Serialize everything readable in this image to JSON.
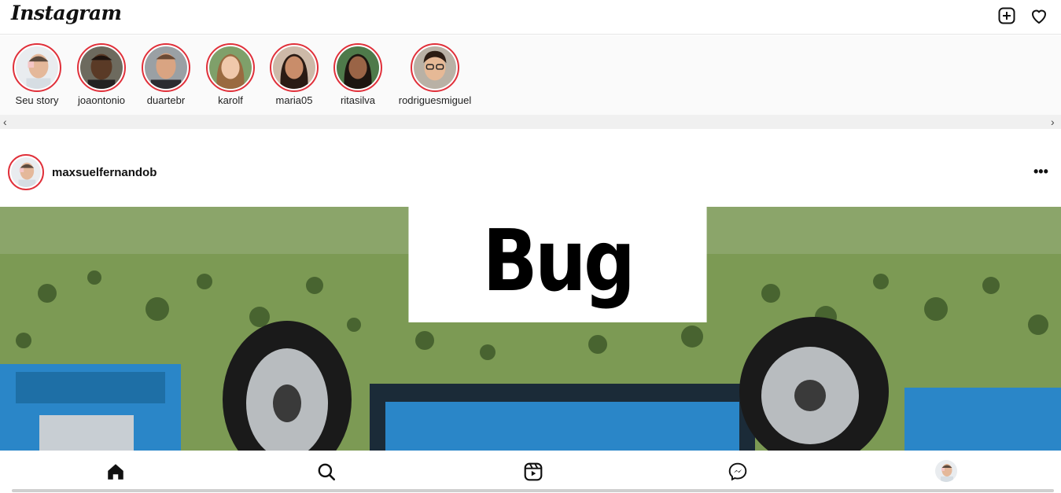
{
  "app": {
    "logo_text": "Instagram"
  },
  "topbar": {
    "icons": [
      "add-post-icon",
      "heart-icon"
    ]
  },
  "stories": [
    {
      "username": "Seu story"
    },
    {
      "username": "joaontonio"
    },
    {
      "username": "duartebr"
    },
    {
      "username": "karolf"
    },
    {
      "username": "maria05"
    },
    {
      "username": "ritasilva"
    },
    {
      "username": "rodriguesmiguel"
    }
  ],
  "scroll": {
    "left_arrow": "‹",
    "right_arrow": "›"
  },
  "post": {
    "username": "maxsuelfernandob",
    "more_label": "•••",
    "image_caption_text": "Bug"
  },
  "bottom_nav": {
    "icons": [
      "home-icon",
      "search-icon",
      "reels-icon",
      "messenger-icon",
      "profile-avatar"
    ]
  },
  "colors": {
    "story_ring": "#e0303a",
    "car_blue": "#2a86c8",
    "grass_green": "#7c9a54"
  }
}
